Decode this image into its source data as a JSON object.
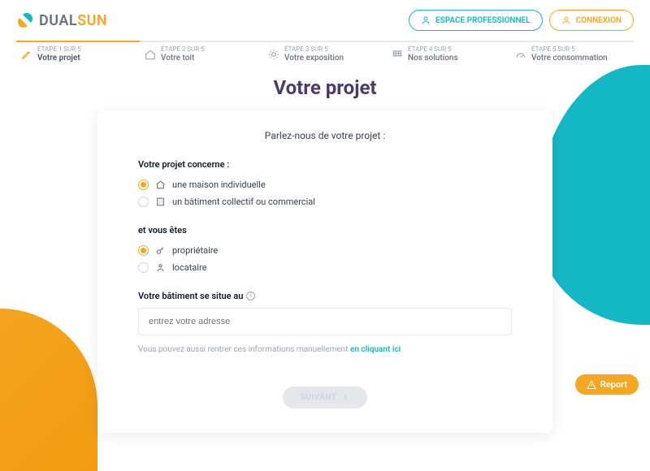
{
  "logo": {
    "part1": "DUAL",
    "part2": "SUN"
  },
  "header": {
    "pro_button": "ESPACE PROFESSIONNEL",
    "login_button": "CONNEXION"
  },
  "stepper": [
    {
      "label": "ÉTAPE 1 SUR 5",
      "title": "Votre projet",
      "icon": "pencil",
      "active": true
    },
    {
      "label": "ÉTAPE 2 SUR 5",
      "title": "Votre toit",
      "icon": "house",
      "active": false
    },
    {
      "label": "ÉTAPE 3 SUR 5",
      "title": "Votre exposition",
      "icon": "sun",
      "active": false
    },
    {
      "label": "ÉTAPE 4 SUR 5",
      "title": "Nos solutions",
      "icon": "panel",
      "active": false
    },
    {
      "label": "ÉTAPE 5 SUR 5",
      "title": "Votre consommation",
      "icon": "meter",
      "active": false
    }
  ],
  "page": {
    "title": "Votre projet",
    "intro": "Parlez-nous de votre projet :"
  },
  "form": {
    "project_type": {
      "label": "Votre projet concerne :",
      "options": [
        {
          "label": "une maison individuelle",
          "icon": "home",
          "checked": true
        },
        {
          "label": "un bâtiment collectif ou commercial",
          "icon": "building",
          "checked": false
        }
      ]
    },
    "role": {
      "label": "et vous êtes",
      "options": [
        {
          "label": "propriétaire",
          "icon": "key",
          "checked": true
        },
        {
          "label": "locataire",
          "icon": "user",
          "checked": false
        }
      ]
    },
    "address": {
      "label": "Votre bâtiment se situe au",
      "placeholder": "entrez votre adresse"
    },
    "manual_hint_prefix": "Vous pouvez aussi rentrer ces informations manuellement ",
    "manual_hint_link": "en cliquant ici",
    "next_button": "SUIVANT"
  },
  "report_button": "Report"
}
